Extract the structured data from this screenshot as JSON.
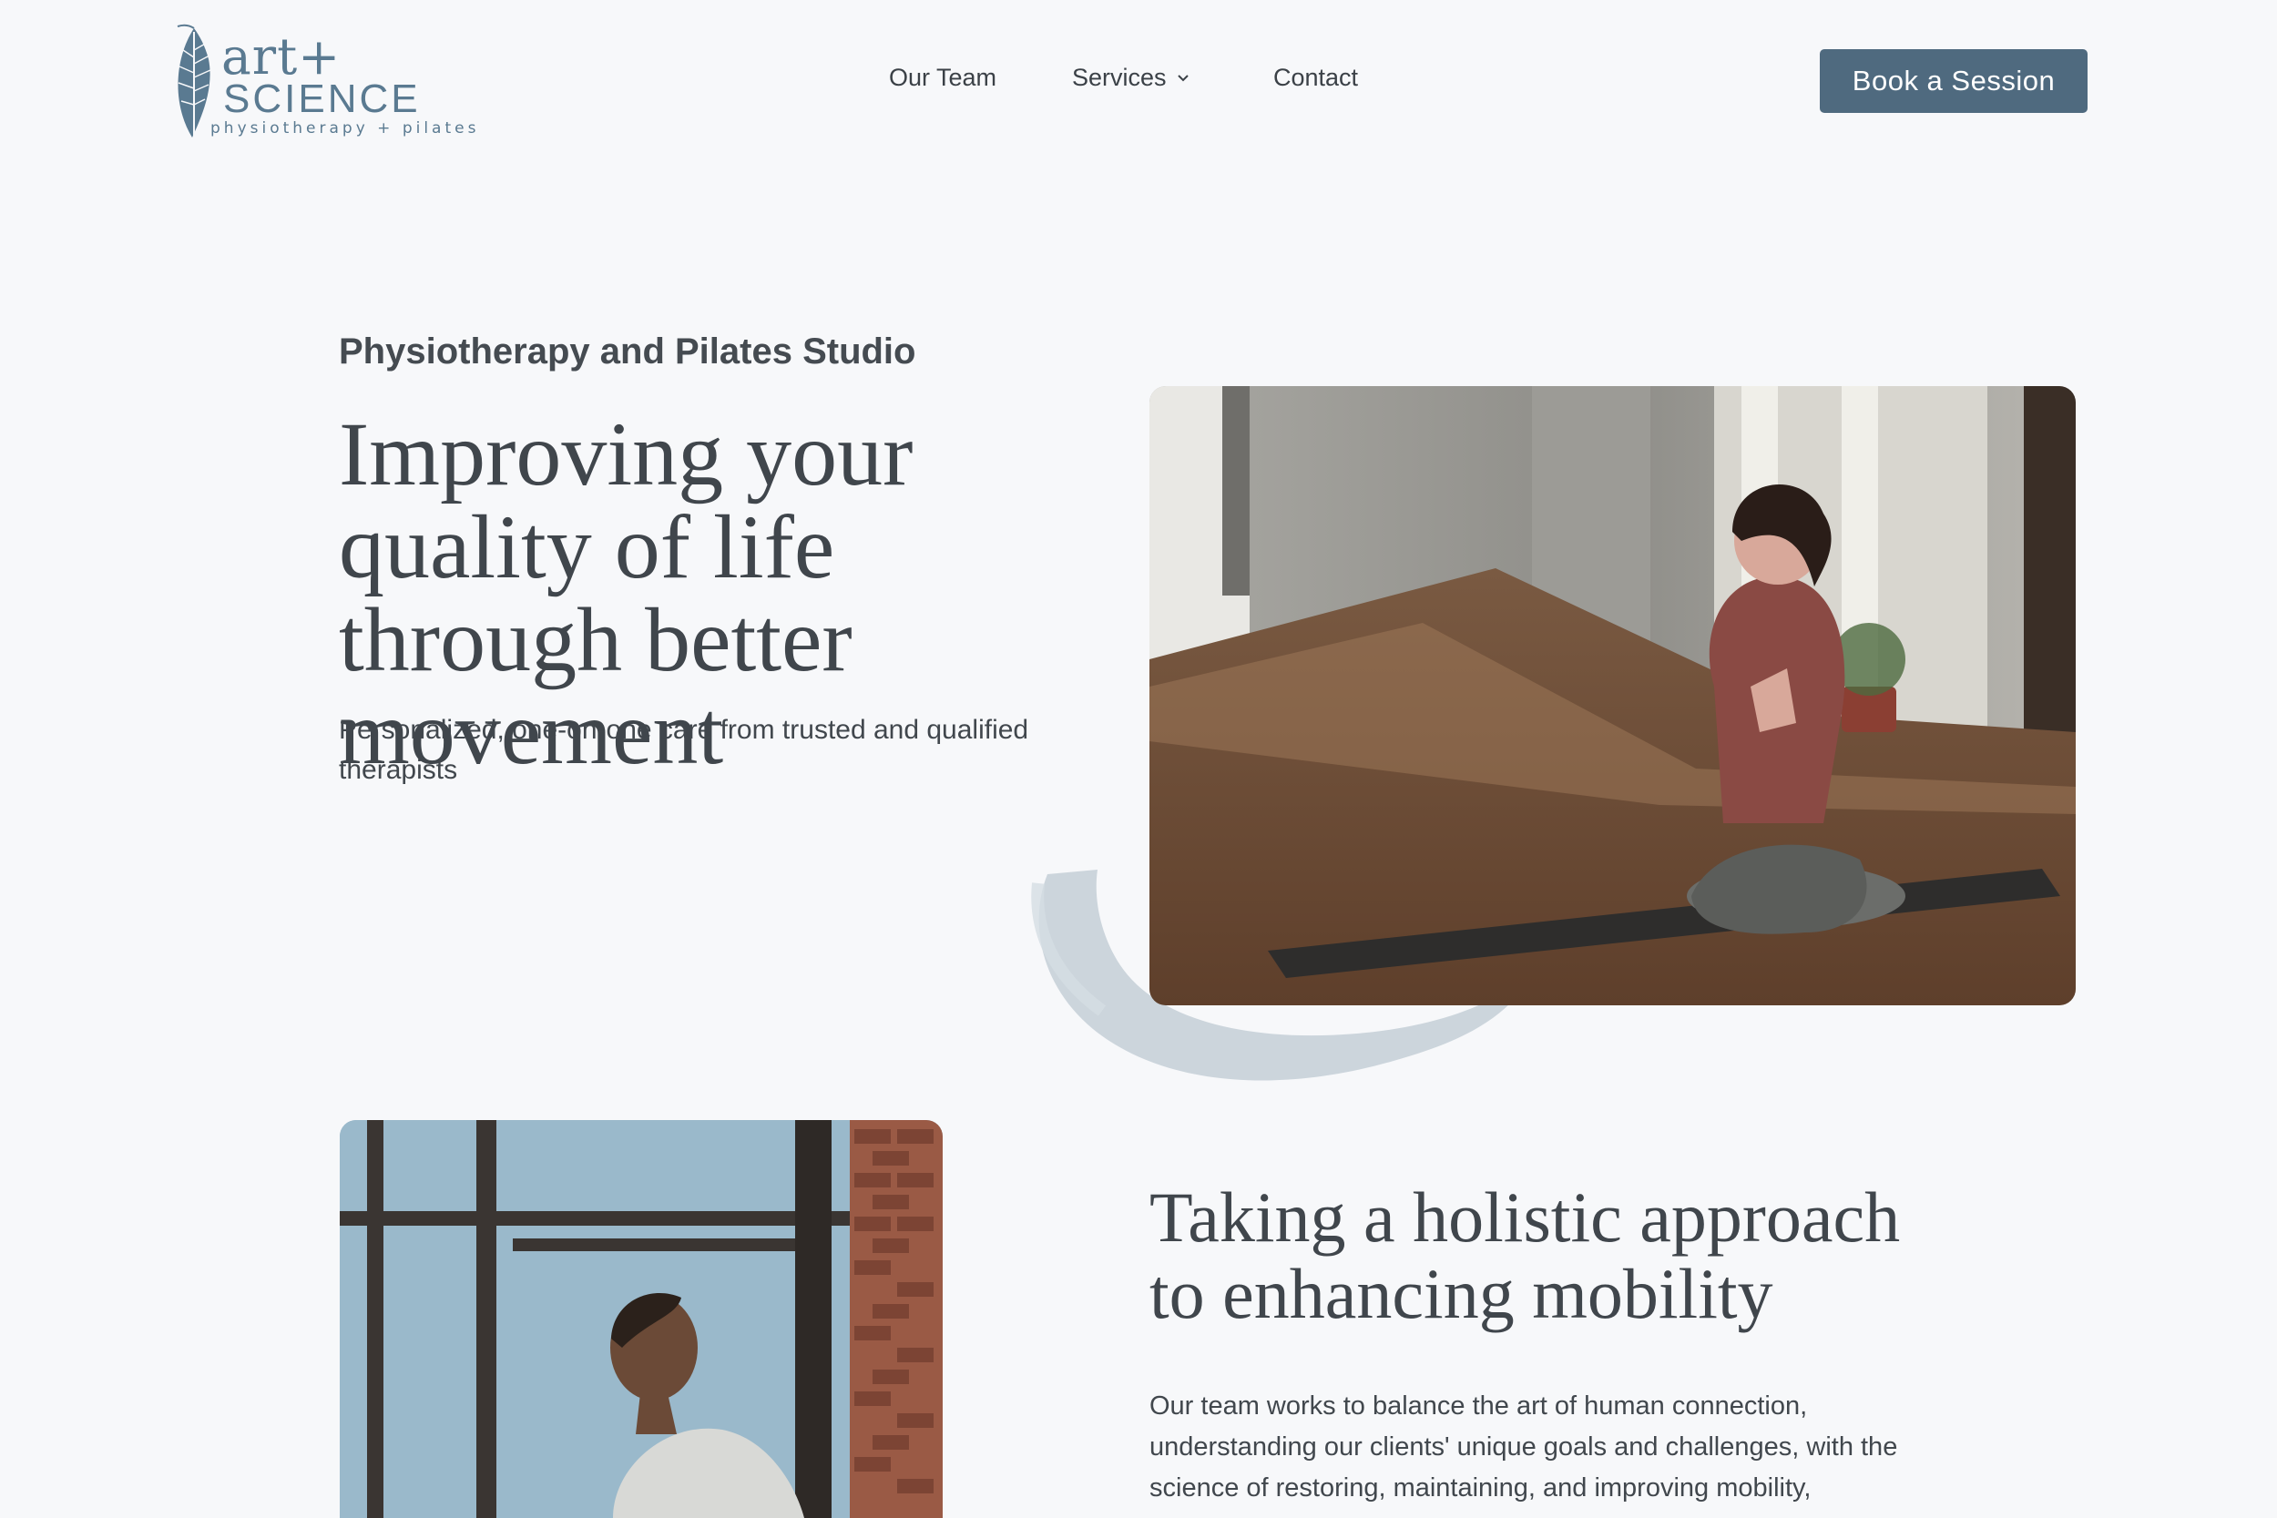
{
  "header": {
    "logo": {
      "art": "art+",
      "science": "SCIENCE",
      "tagline": "physiotherapy + pilates"
    },
    "nav": {
      "our_team": "Our Team",
      "services": "Services",
      "contact": "Contact"
    },
    "cta": "Book a Session"
  },
  "hero": {
    "eyebrow": "Physiotherapy and Pilates Studio",
    "title": "Improving your quality of life through better movement",
    "subtitle": "Personalized, one-on-one care from trusted and qualified therapists"
  },
  "section2": {
    "title": "Taking a holistic approach to enhancing mobility",
    "body": "Our team works to balance the art of human connection, understanding our clients' unique goals and challenges, with the science of restoring, maintaining, and improving mobility,"
  },
  "colors": {
    "brand": "#5a7a91",
    "button": "#4f6a7f",
    "background": "#f7f8fa",
    "text": "#40464c"
  },
  "icons": {
    "logo": "leaf-icon",
    "services_dropdown": "chevron-down-icon"
  }
}
